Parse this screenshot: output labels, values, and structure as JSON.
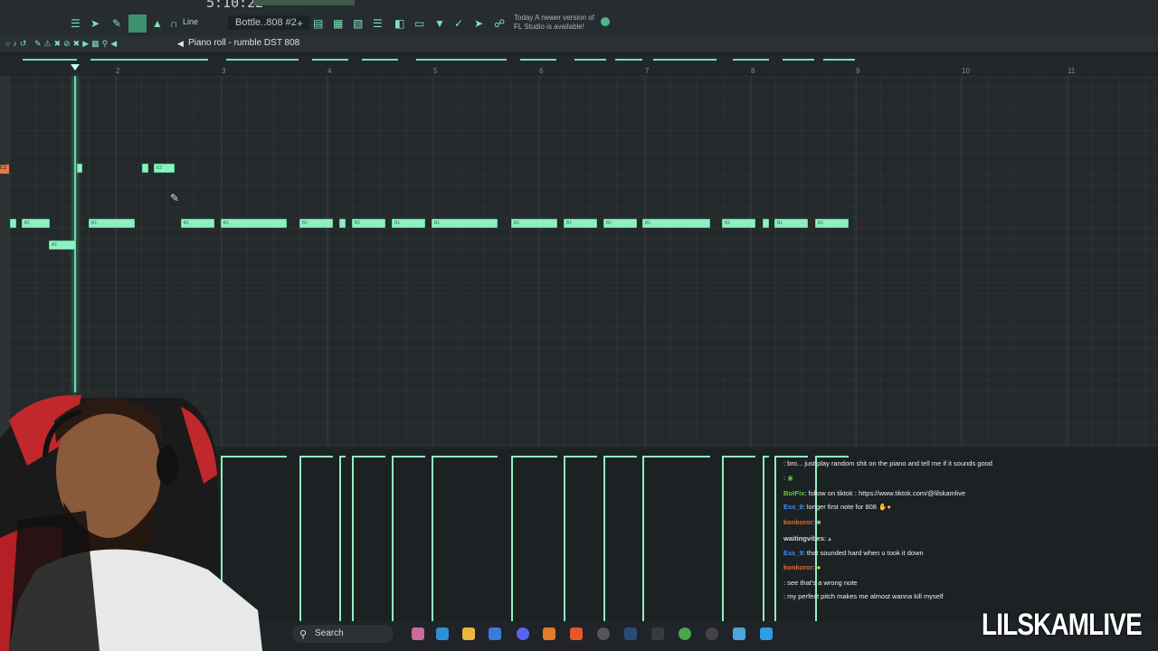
{
  "toolbar": {
    "time": "5:10:22",
    "mode_label": "Line",
    "pattern_label": "Bottle..808 #2",
    "hint_title": "Today",
    "hint_text": "A newer version of FL Studio is available!"
  },
  "piano_roll": {
    "title": "Piano roll - rumble DST 808",
    "ruler_numbers": [
      "2",
      "3",
      "4",
      "5",
      "6",
      "7",
      "8",
      "9",
      "10",
      "11"
    ],
    "note_label_high": "E2",
    "note_label_mid": "B1",
    "note_label_low": "A1"
  },
  "chat": {
    "messages": [
      {
        "user": "",
        "text": ": bro... just play random shit on the piano and tell me if it sounds good",
        "color": "#e04a5a"
      },
      {
        "user": "",
        "text": ":",
        "color": "#e04a5a"
      },
      {
        "user": "BotFix",
        "text": ": follow on tiktok : https://www.tiktok.com/@lilskamlive",
        "color": "#62c93e"
      },
      {
        "user": "Ess_9",
        "text": ": longer first note for 808",
        "color": "#3f8fff"
      },
      {
        "user": "konkoror",
        "text": ":",
        "color": "#e06a3a"
      },
      {
        "user": "waitingvibes",
        "text": ":",
        "color": "#d7d7d7"
      },
      {
        "user": "Ess_9",
        "text": ": that sounded hard when u took it down",
        "color": "#3f8fff"
      },
      {
        "user": "konkoror",
        "text": ":",
        "color": "#e06a3a"
      },
      {
        "user": "",
        "text": ": see that's a wrong note",
        "color": "#e04a5a"
      },
      {
        "user": "",
        "text": ": my perfect pitch makes me almost wanna kill myself",
        "color": "#e04a5a"
      }
    ]
  },
  "taskbar": {
    "search_label": "Search"
  },
  "watermark": "LILSKAMLIVE",
  "colors": {
    "accent": "#8ff0bf",
    "background": "#24292b"
  }
}
